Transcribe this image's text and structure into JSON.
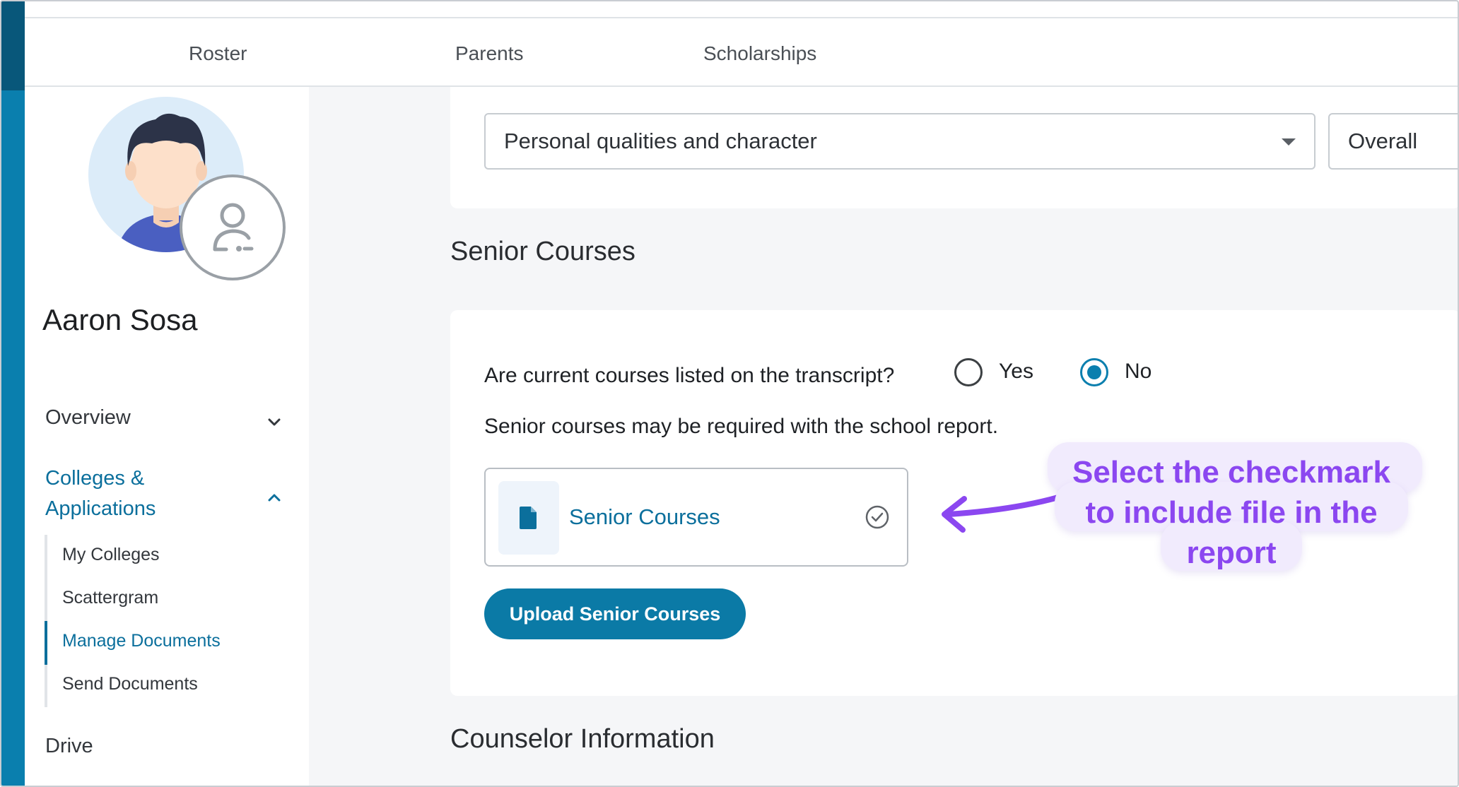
{
  "topnav": {
    "tabs": [
      "Roster",
      "Parents",
      "Scholarships"
    ]
  },
  "student": {
    "name": "Aaron Sosa"
  },
  "sidebar": {
    "overview": "Overview",
    "colleges_line1": "Colleges &",
    "colleges_line2": "Applications",
    "subitems": [
      "My Colleges",
      "Scattergram",
      "Manage Documents",
      "Send Documents"
    ],
    "active_subitem": "Manage Documents",
    "drive": "Drive"
  },
  "filters": {
    "quality_select": "Personal qualities and character",
    "rating_select": "Overall"
  },
  "senior_courses": {
    "title": "Senior Courses",
    "question": "Are current courses listed on the transcript?",
    "options": [
      "Yes",
      "No"
    ],
    "selected": "No",
    "hint": "Senior courses may be required with the school report.",
    "file_name": "Senior Courses",
    "upload_label": "Upload Senior Courses"
  },
  "counselor": {
    "title": "Counselor Information"
  },
  "annotation": {
    "text_line1": "Select the checkmark",
    "text_line2": "to include file in the",
    "text_line3": "report",
    "color": "#8b47f0"
  },
  "colors": {
    "accent": "#0b7aa6",
    "rail": "#0a7fae"
  }
}
